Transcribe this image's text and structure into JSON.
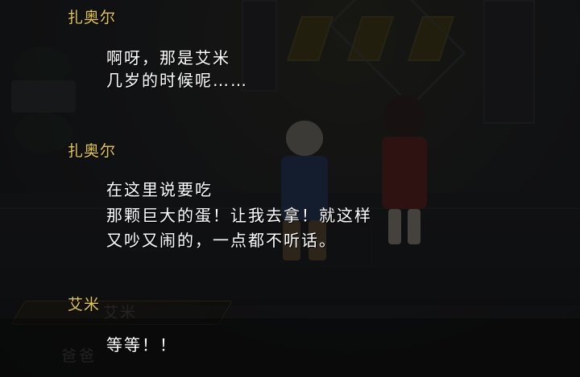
{
  "log": [
    {
      "speaker": "扎奥尔",
      "lines": [
        "啊呀，那是艾米",
        "几岁的时候呢……"
      ]
    },
    {
      "speaker": "扎奥尔",
      "lines": [
        "在这里说要吃",
        "那颗巨大的蛋！让我去拿！就这样",
        "又吵又闹的，一点都不听话。"
      ]
    },
    {
      "speaker": "艾米",
      "lines": [
        "等等！！"
      ]
    }
  ],
  "dialogue_box": {
    "name": "艾米",
    "text": "爸爸"
  },
  "colors": {
    "speaker_name": "#e2c84a",
    "dialogue_text": "#ffffff",
    "overlay": "rgba(10,10,10,0.72)"
  }
}
